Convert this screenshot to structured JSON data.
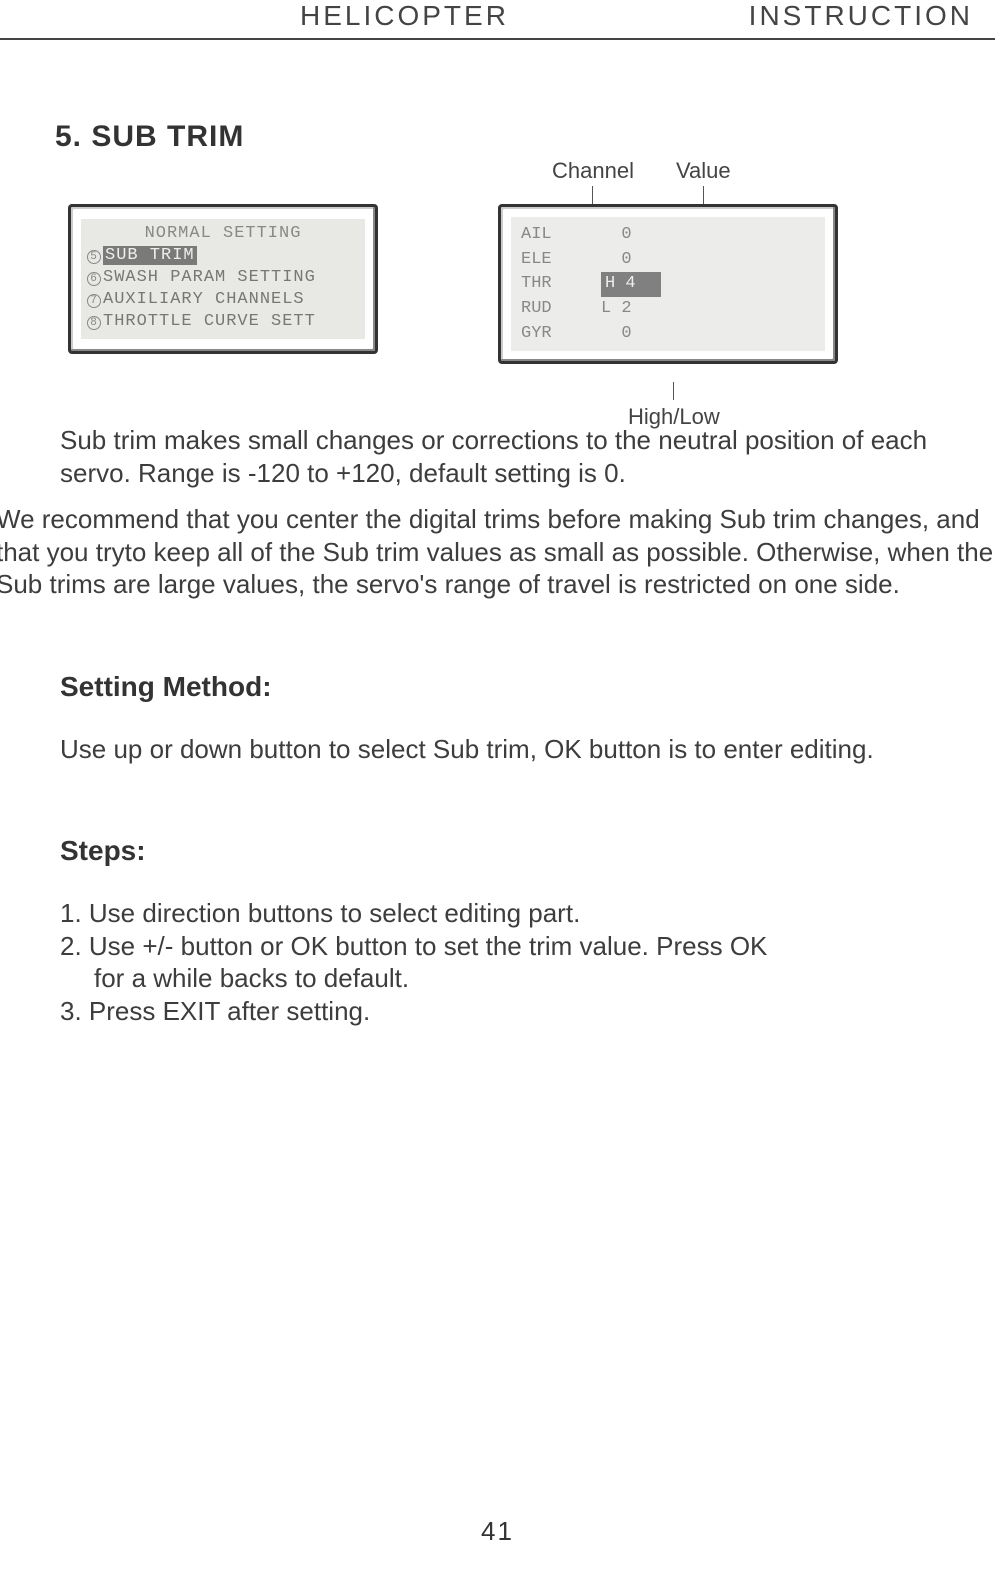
{
  "header": {
    "left": "HELICOPTER",
    "right": "INSTRUCTION"
  },
  "section_title": "5. SUB TRIM",
  "lcd1": {
    "header": "NORMAL SETTING",
    "items": [
      {
        "num": "5",
        "label": "SUB TRIM",
        "highlighted": true
      },
      {
        "num": "6",
        "label": "SWASH PARAM SETTING",
        "highlighted": false
      },
      {
        "num": "7",
        "label": "AUXILIARY CHANNELS",
        "highlighted": false
      },
      {
        "num": "8",
        "label": "THROTTLE CURVE SETT",
        "highlighted": false
      }
    ]
  },
  "callouts": {
    "channel": "Channel",
    "value": "Value",
    "hilo": "High/Low"
  },
  "lcd2": {
    "rows": [
      {
        "ch": "AIL",
        "hl": "",
        "val": "0",
        "highlighted": false
      },
      {
        "ch": "ELE",
        "hl": "",
        "val": "0",
        "highlighted": false
      },
      {
        "ch": "THR",
        "hl": "H",
        "val": "4",
        "highlighted": true
      },
      {
        "ch": "RUD",
        "hl": "L",
        "val": "2",
        "highlighted": false
      },
      {
        "ch": "GYR",
        "hl": "",
        "val": "0",
        "highlighted": false
      }
    ]
  },
  "para1": "Sub trim makes small changes or corrections to the neutral position of each servo. Range is -120 to +120, default setting is 0.",
  "para2": "We recommend that you center the digital trims before making Sub trim changes, and that you tryto keep all of the Sub trim values as small as possible. Otherwise, when the Sub trims are large values, the servo's range of travel is restricted on one side.",
  "setting_method_heading": "Setting Method:",
  "setting_method_text": "Use up or down button to select Sub trim, OK button is to enter editing.",
  "steps_heading": "Steps:",
  "steps": [
    "1. Use direction buttons to select editing part.",
    "2. Use +/- button or OK button to set the trim value. Press OK",
    "    for a while backs to default.",
    "3. Press EXIT after setting."
  ],
  "page_number": "41"
}
